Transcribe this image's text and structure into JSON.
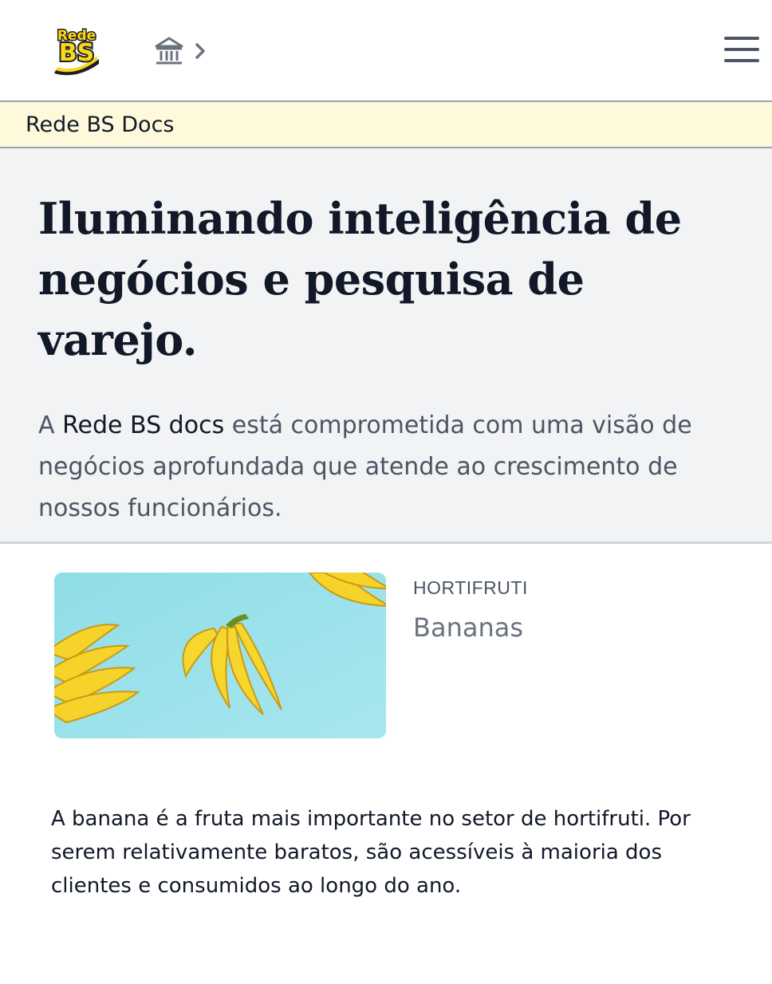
{
  "header": {
    "logo_text_top": "Rede",
    "logo_text_bottom": "BS",
    "icons": [
      "home-icon",
      "chevron-right-icon",
      "menu-icon"
    ],
    "brand_yellow": "#f9d71c",
    "brand_dark": "#1f1f1f"
  },
  "banner": {
    "title": "Rede BS Docs",
    "background": "#fef9db"
  },
  "hero": {
    "heading": "Iluminando inteligência de negócios e pesquisa de varejo.",
    "intro_prefix": "A ",
    "intro_brand": "Rede BS docs",
    "intro_rest": " está comprometida com uma visão de negócios aprofundada que atende ao crescimento de nossos funcionários.",
    "background": "#f2f3f5"
  },
  "article": {
    "category": "HORTIFRUTI",
    "title": "Bananas",
    "image": "bananas-on-light-blue-background",
    "body": "A banana é a fruta mais importante no setor de hortifruti. Por serem relativamente baratos, são acessíveis à maioria dos clientes e consumidos ao longo do ano."
  }
}
